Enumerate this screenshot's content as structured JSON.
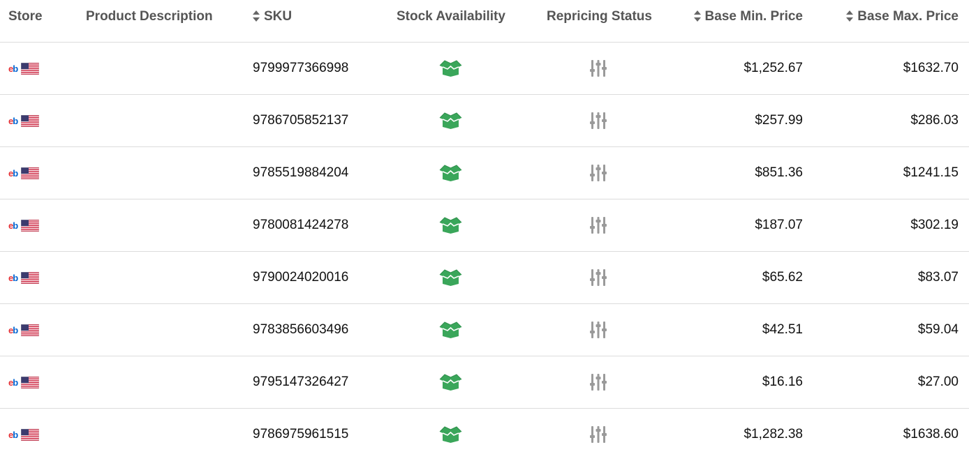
{
  "columns": {
    "store": "Store",
    "description": "Product Description",
    "sku": "SKU",
    "stock": "Stock Availability",
    "repricing": "Repricing Status",
    "min_price": "Base Min. Price",
    "max_price": "Base Max. Price"
  },
  "icons": {
    "store_logo": "ebay-logo-icon",
    "store_flag": "us-flag-icon",
    "stock": "green-box-icon",
    "repricing": "sliders-icon",
    "sort": "sort-arrows-icon"
  },
  "colors": {
    "stock_green": "#3aa65a",
    "repricing_gray": "#9a9a9a",
    "header_text": "#555555",
    "ebay_e": "#e53238",
    "ebay_b": "#0064d2"
  },
  "rows": [
    {
      "sku": "9799977366998",
      "min_price": "$1,252.67",
      "max_price": "$1632.70"
    },
    {
      "sku": "9786705852137",
      "min_price": "$257.99",
      "max_price": "$286.03"
    },
    {
      "sku": "9785519884204",
      "min_price": "$851.36",
      "max_price": "$1241.15"
    },
    {
      "sku": "9780081424278",
      "min_price": "$187.07",
      "max_price": "$302.19"
    },
    {
      "sku": "9790024020016",
      "min_price": "$65.62",
      "max_price": "$83.07"
    },
    {
      "sku": "9783856603496",
      "min_price": "$42.51",
      "max_price": "$59.04"
    },
    {
      "sku": "9795147326427",
      "min_price": "$16.16",
      "max_price": "$27.00"
    },
    {
      "sku": "9786975961515",
      "min_price": "$1,282.38",
      "max_price": "$1638.60"
    }
  ]
}
